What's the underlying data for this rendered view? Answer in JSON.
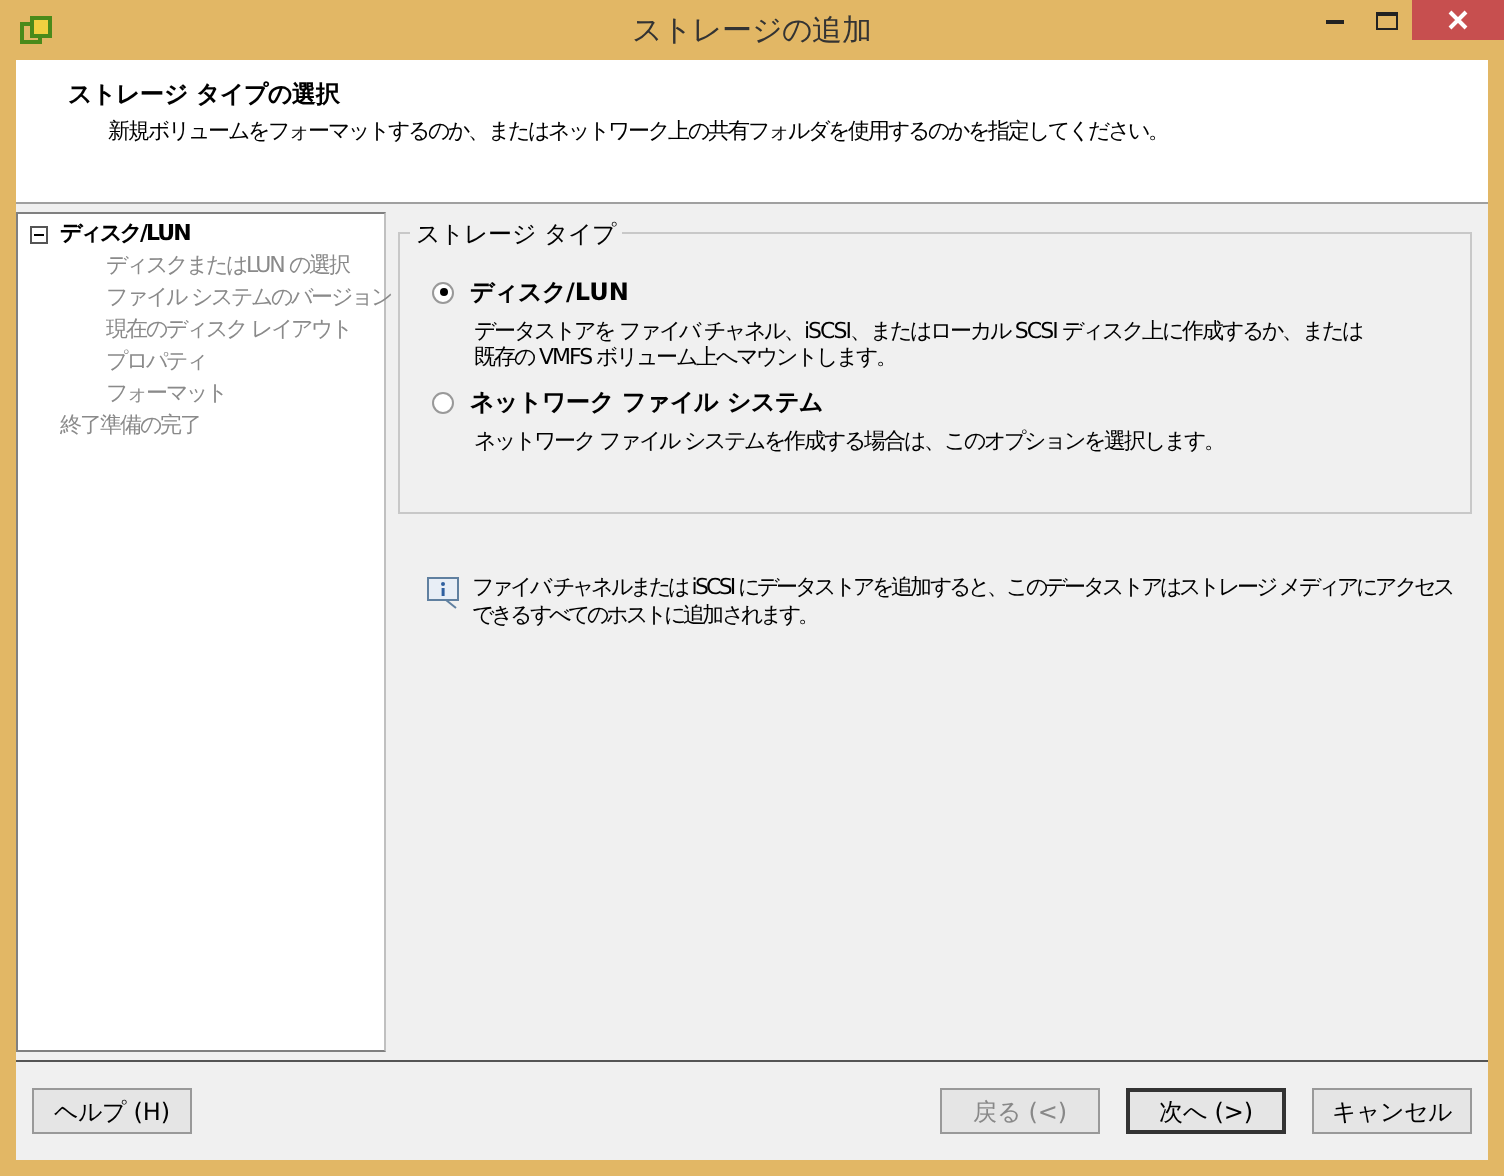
{
  "window": {
    "title": "ストレージの追加"
  },
  "header": {
    "title": "ストレージ タイプの選択",
    "subtitle": "新規ボリュームをフォーマットするのか、またはネットワーク上の共有フォルダを使用するのかを指定してください。"
  },
  "steps": [
    {
      "label": "ディスク/LUN",
      "current": true,
      "expanded": true,
      "children": [
        {
          "label": "ディスクまたはLUN の選択",
          "current": false
        },
        {
          "label": "ファイル システムのバージョン",
          "current": false
        },
        {
          "label": "現在のディスク レイアウト",
          "current": false
        },
        {
          "label": "プロパティ",
          "current": false
        },
        {
          "label": "フォーマット",
          "current": false
        }
      ]
    },
    {
      "label": "終了準備の完了",
      "current": false
    }
  ],
  "storage_type": {
    "legend": "ストレージ タイプ",
    "options": [
      {
        "label": "ディスク/LUN",
        "selected": true,
        "description": [
          "データストアを ファイバ チャネル、iSCSI、またはローカル SCSI ディスク上に作成するか、または",
          "既存の VMFS ボリューム上へマウントします。"
        ]
      },
      {
        "label": "ネットワーク ファイル システム",
        "selected": false,
        "description": [
          "ネットワーク ファイル システムを作成する場合は、このオプションを選択します。"
        ]
      }
    ]
  },
  "info": [
    "ファイバ チャネルまたは iSCSI にデータストアを追加すると、このデータストアはストレージ メディアにアクセス",
    "できるすべてのホストに追加されます。"
  ],
  "buttons_left": [
    {
      "label": "ヘルプ (H)",
      "disabled": false,
      "default": false
    }
  ],
  "buttons_right": [
    {
      "label": "戻る (<)",
      "disabled": true,
      "default": false
    },
    {
      "label": "次へ (>)",
      "disabled": false,
      "default": true
    },
    {
      "label": "キャンセル",
      "disabled": false,
      "default": false
    }
  ]
}
